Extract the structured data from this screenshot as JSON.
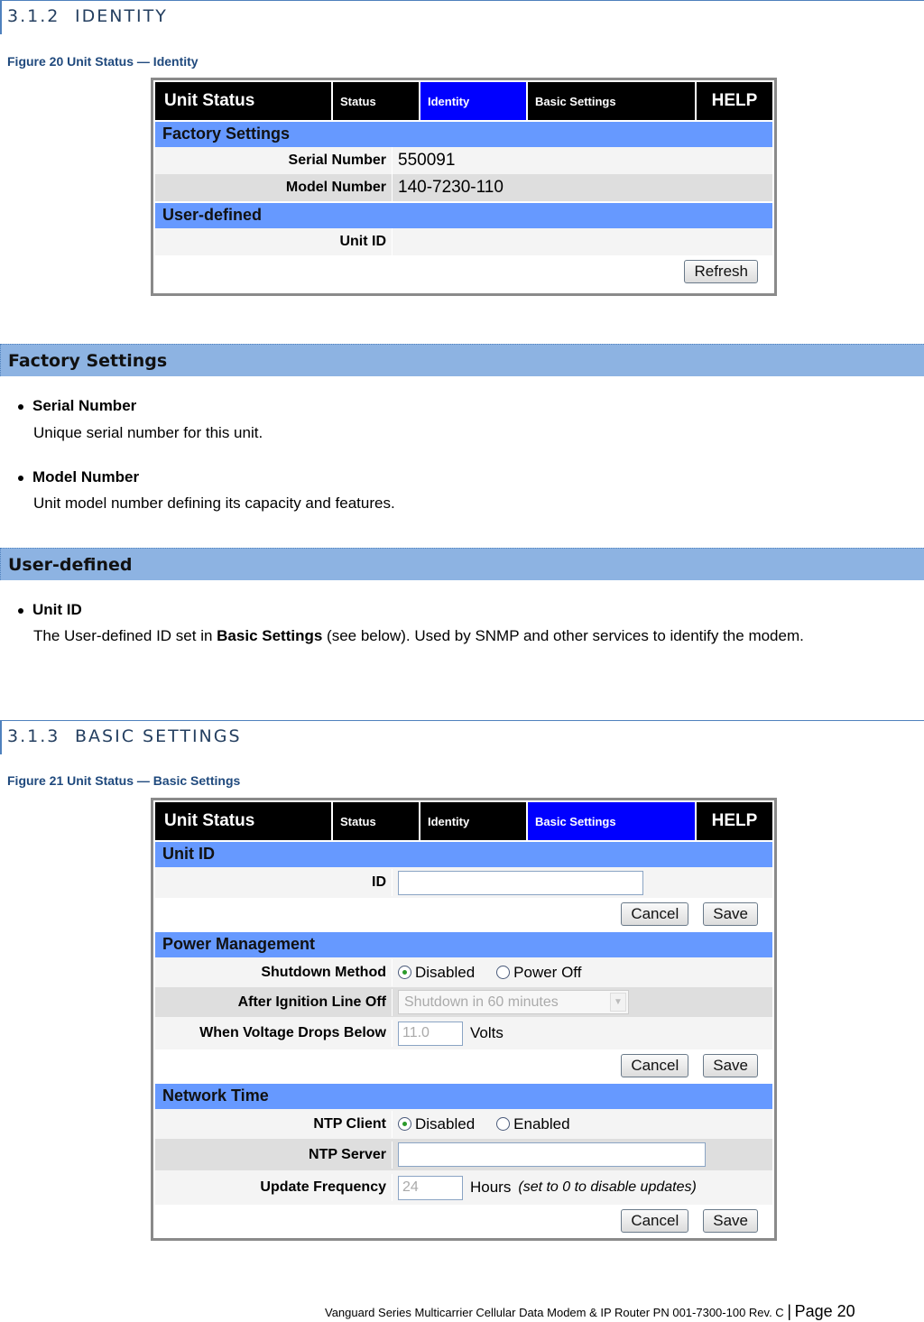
{
  "section_312": {
    "number": "3.1.2",
    "title": "IDENTITY"
  },
  "figure20": {
    "caption": "Figure 20 Unit Status — Identity"
  },
  "identity_ui": {
    "nav": {
      "title": "Unit Status",
      "tabs": [
        "Status",
        "Identity",
        "Basic Settings"
      ],
      "active_tab": "Identity",
      "help": "HELP"
    },
    "factory_header": "Factory Settings",
    "serial_label": "Serial Number",
    "serial_value": "550091",
    "model_label": "Model Number",
    "model_value": "140-7230-110",
    "userdef_header": "User-defined",
    "unitid_label": "Unit ID",
    "unitid_value": "",
    "refresh_button": "Refresh"
  },
  "factory_band": "Factory Settings",
  "factory_items": [
    {
      "term": "Serial Number",
      "desc": "Unique serial number for this unit."
    },
    {
      "term": "Model Number",
      "desc": "Unit model number defining its capacity and features."
    }
  ],
  "userdef_band": "User-defined",
  "userdef_items": [
    {
      "term": "Unit ID",
      "desc_pre": "The User-defined ID set in ",
      "desc_bold": "Basic Settings",
      "desc_post": " (see below). Used by SNMP and other services to identify the modem."
    }
  ],
  "section_313": {
    "number": "3.1.3",
    "title": "BASIC SETTINGS"
  },
  "figure21": {
    "caption": "Figure 21 Unit Status — Basic Settings"
  },
  "basic_ui": {
    "nav": {
      "title": "Unit Status",
      "tabs": [
        "Status",
        "Identity",
        "Basic Settings"
      ],
      "active_tab": "Basic Settings",
      "help": "HELP"
    },
    "unitid_header": "Unit ID",
    "id_label": "ID",
    "id_value": "",
    "cancel": "Cancel",
    "save": "Save",
    "power_header": "Power Management",
    "shutdown_label": "Shutdown Method",
    "shutdown_options": [
      "Disabled",
      "Power Off"
    ],
    "shutdown_selected": "Disabled",
    "ignition_label": "After Ignition Line Off",
    "ignition_value": "Shutdown in 60 minutes",
    "voltage_label": "When Voltage Drops Below",
    "voltage_value": "11.0",
    "voltage_unit": "Volts",
    "ntp_header": "Network Time",
    "ntp_client_label": "NTP Client",
    "ntp_client_options": [
      "Disabled",
      "Enabled"
    ],
    "ntp_client_selected": "Disabled",
    "ntp_server_label": "NTP Server",
    "ntp_server_value": "",
    "update_label": "Update Frequency",
    "update_value": "24",
    "update_unit": "Hours",
    "update_hint": "(set to 0 to disable updates)"
  },
  "footer": {
    "text": "Vanguard Series Multicarrier Cellular Data Modem & IP Router PN 001-7300-100 Rev. C",
    "separator": "|",
    "page": "Page 20"
  }
}
